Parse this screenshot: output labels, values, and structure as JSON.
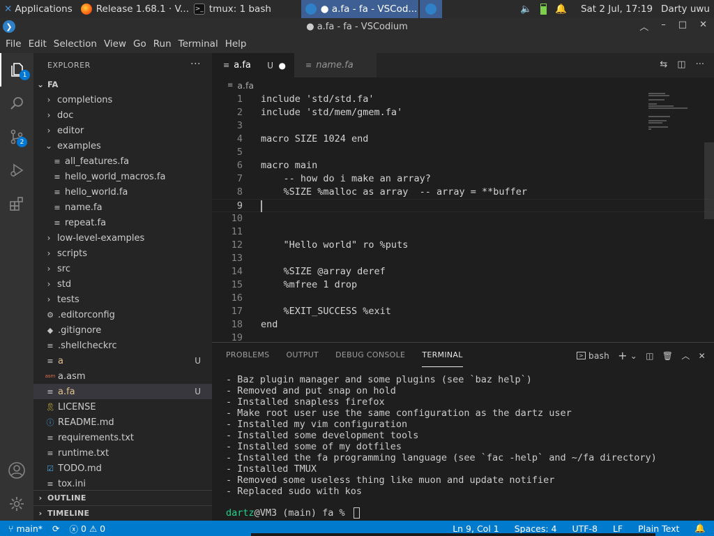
{
  "taskbar": {
    "applications": "Applications",
    "firefox": "Release 1.68.1 · V...",
    "tmux": "tmux: 1 bash",
    "vscode": "● a.fa - fa - VSCod...",
    "datetime": "Sat  2 Jul, 17:19",
    "user": "Darty uwu"
  },
  "window": {
    "title": "● a.fa - fa - VSCodium"
  },
  "menu": [
    "File",
    "Edit",
    "Selection",
    "View",
    "Go",
    "Run",
    "Terminal",
    "Help"
  ],
  "activity": {
    "explorer_badge": "1",
    "scm_badge": "2"
  },
  "explorer": {
    "header": "EXPLORER",
    "root": "FA",
    "items": [
      {
        "label": "completions",
        "type": "folder",
        "open": false,
        "indent": 1
      },
      {
        "label": "doc",
        "type": "folder",
        "open": false,
        "indent": 1
      },
      {
        "label": "editor",
        "type": "folder",
        "open": false,
        "indent": 1
      },
      {
        "label": "examples",
        "type": "folder",
        "open": true,
        "indent": 1
      },
      {
        "label": "all_features.fa",
        "type": "file",
        "indent": 2
      },
      {
        "label": "hello_world_macros.fa",
        "type": "file",
        "indent": 2
      },
      {
        "label": "hello_world.fa",
        "type": "file",
        "indent": 2
      },
      {
        "label": "name.fa",
        "type": "file",
        "indent": 2
      },
      {
        "label": "repeat.fa",
        "type": "file",
        "indent": 2
      },
      {
        "label": "low-level-examples",
        "type": "folder",
        "open": false,
        "indent": 1
      },
      {
        "label": "scripts",
        "type": "folder",
        "open": false,
        "indent": 1
      },
      {
        "label": "src",
        "type": "folder",
        "open": false,
        "indent": 1
      },
      {
        "label": "std",
        "type": "folder",
        "open": false,
        "indent": 1
      },
      {
        "label": "tests",
        "type": "folder",
        "open": false,
        "indent": 1
      },
      {
        "label": ".editorconfig",
        "type": "file",
        "icon": "gear",
        "indent": 1
      },
      {
        "label": ".gitignore",
        "type": "file",
        "icon": "git",
        "indent": 1
      },
      {
        "label": ".shellcheckrc",
        "type": "file",
        "indent": 1
      },
      {
        "label": "a",
        "type": "file",
        "indent": 1,
        "status": "U"
      },
      {
        "label": "a.asm",
        "type": "file",
        "icon": "asm",
        "indent": 1
      },
      {
        "label": "a.fa",
        "type": "file",
        "indent": 1,
        "status": "U",
        "selected": true
      },
      {
        "label": "LICENSE",
        "type": "file",
        "icon": "license",
        "indent": 1
      },
      {
        "label": "README.md",
        "type": "file",
        "icon": "info",
        "indent": 1
      },
      {
        "label": "requirements.txt",
        "type": "file",
        "indent": 1
      },
      {
        "label": "runtime.txt",
        "type": "file",
        "indent": 1
      },
      {
        "label": "TODO.md",
        "type": "file",
        "icon": "check",
        "indent": 1
      },
      {
        "label": "tox.ini",
        "type": "file",
        "indent": 1
      }
    ],
    "outline": "OUTLINE",
    "timeline": "TIMELINE"
  },
  "tabs": [
    {
      "label": "a.fa",
      "status": "U",
      "active": true
    },
    {
      "label": "name.fa",
      "active": false
    }
  ],
  "breadcrumb": "a.fa",
  "code": [
    "include 'std/std.fa'",
    "include 'std/mem/gmem.fa'",
    "",
    "macro SIZE 1024 end",
    "",
    "macro main",
    "    -- how do i make an array?",
    "    %SIZE %malloc as array  -- array = **buffer",
    "",
    "",
    "",
    "    \"Hello world\" ro %puts",
    "",
    "    %SIZE @array deref",
    "    %mfree 1 drop",
    "",
    "    %EXIT_SUCCESS %exit",
    "end",
    ""
  ],
  "current_line": 9,
  "panel": {
    "tabs": [
      "PROBLEMS",
      "OUTPUT",
      "DEBUG CONSOLE",
      "TERMINAL"
    ],
    "active_tab": "TERMINAL",
    "shell": "bash"
  },
  "terminal": {
    "lines": [
      "- Baz plugin manager and some plugins (see `baz help`)",
      "- Removed and put snap on hold",
      "- Installed snapless firefox",
      "- Make root user use the same configuration as the dartz user",
      "- Installed my vim configuration",
      "- Installed some development tools",
      "- Installed some of my dotfiles",
      "- Installed the fa programming language (see `fac -help` and ~/fa directory)",
      "- Installed TMUX",
      "- Removed some useless thing like muon and update notifier",
      "- Replaced sudo with kos"
    ],
    "prompt_user": "dartz",
    "prompt_rest": "@VM3 (main) fa % "
  },
  "status": {
    "branch": "main*",
    "errors": "0",
    "warnings": "0",
    "position": "Ln 9, Col 1",
    "spaces": "Spaces: 4",
    "encoding": "UTF-8",
    "eol": "LF",
    "language": "Plain Text"
  },
  "colors": {
    "accent": "#007acc",
    "modified": "#e2c08d",
    "prompt_user": "#23d18b",
    "taskbar_active": "#3d5f94"
  }
}
